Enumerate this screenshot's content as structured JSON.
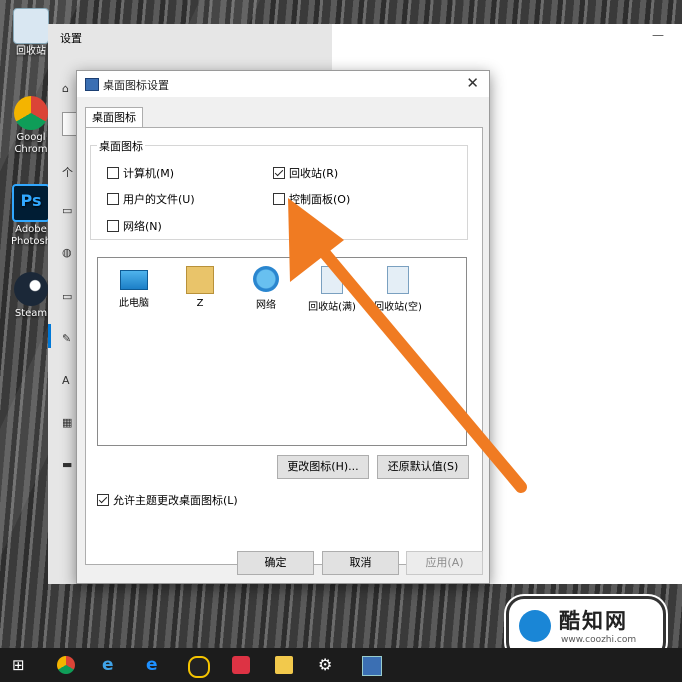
{
  "desktop": {
    "icons": [
      {
        "label": "回收站"
      },
      {
        "label": "Googl Chrom"
      },
      {
        "label": "Adobe Photosh"
      },
      {
        "label": "Steam"
      }
    ]
  },
  "settings": {
    "title": "设置",
    "close": "—"
  },
  "dialog": {
    "title": "桌面图标设置",
    "close": "✕",
    "tab": "桌面图标",
    "group_label": "桌面图标",
    "checkboxes": [
      {
        "label": "计算机(M)",
        "checked": false
      },
      {
        "label": "回收站(R)",
        "checked": true
      },
      {
        "label": "用户的文件(U)",
        "checked": false
      },
      {
        "label": "控制面板(O)",
        "checked": false
      },
      {
        "label": "网络(N)",
        "checked": false
      }
    ],
    "icon_list": [
      {
        "label": "此电脑",
        "icon": "computer-icon"
      },
      {
        "label": "Z",
        "icon": "user-folder-icon"
      },
      {
        "label": "网络",
        "icon": "network-icon"
      },
      {
        "label": "回收站(满)",
        "icon": "recycle-bin-full-icon"
      },
      {
        "label": "回收站(空)",
        "icon": "recycle-bin-empty-icon"
      }
    ],
    "change_icon_button": "更改图标(H)...",
    "restore_default_button": "还原默认值(S)",
    "allow_themes_label": "允许主题更改桌面图标(L)",
    "allow_themes_checked": true,
    "ok_button": "确定",
    "cancel_button": "取消",
    "apply_button": "应用(A)"
  },
  "watermark": {
    "brand": "酷知网",
    "url": "www.coozhi.com"
  },
  "colors": {
    "arrow": "#f07b22",
    "accent": "#0078d7"
  }
}
